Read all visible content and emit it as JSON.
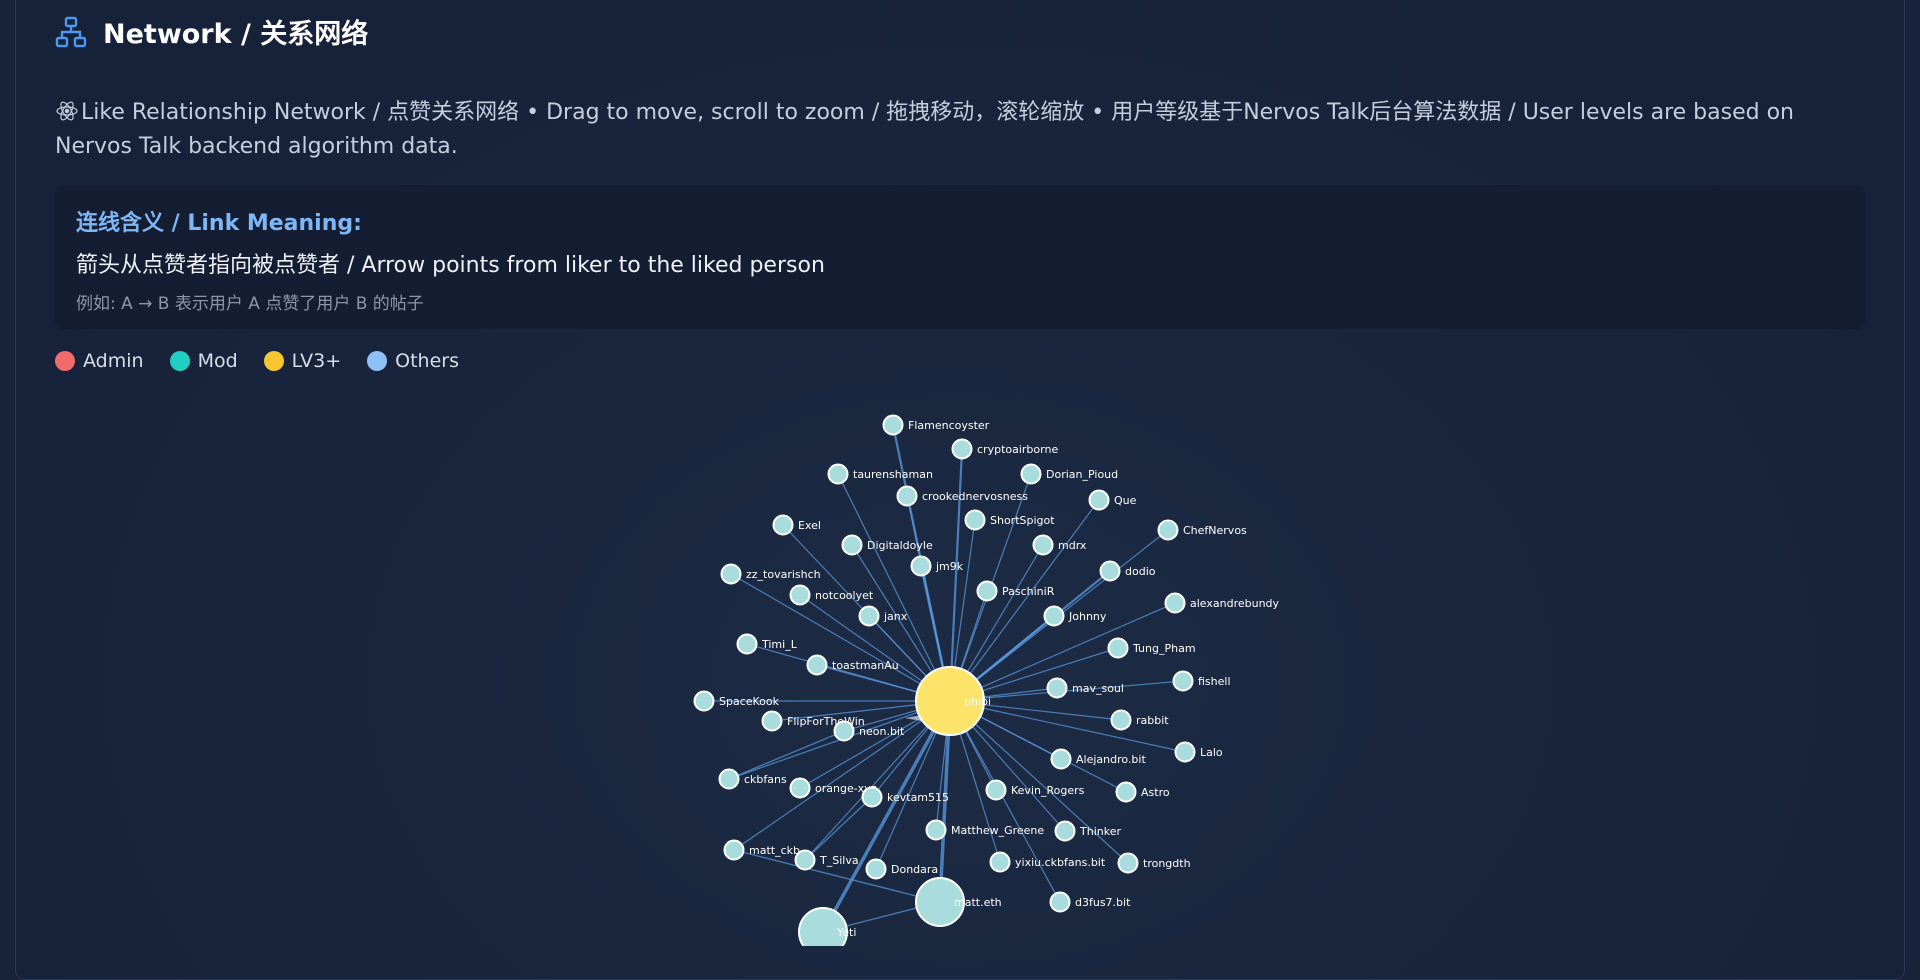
{
  "header": {
    "title": "Network / 关系网络",
    "icon": "network-icon"
  },
  "description": "Like Relationship Network / 点赞关系网络 • Drag to move, scroll to zoom / 拖拽移动，滚轮缩放 • 用户等级基于Nervos Talk后台算法数据 / User levels are based on Nervos Talk backend algorithm data.",
  "link_info": {
    "heading": "连线含义 / Link Meaning:",
    "meaning": "箭头从点赞者指向被点赞者 / Arrow points from liker to the liked person",
    "example": "例如: A → B 表示用户 A 点赞了用户 B 的帖子"
  },
  "legend": [
    {
      "label": "Admin",
      "color": "#f26b6b"
    },
    {
      "label": "Mod",
      "color": "#1fcfc1"
    },
    {
      "label": "LV3+",
      "color": "#f8c630"
    },
    {
      "label": "Others",
      "color": "#8fc1f7"
    }
  ],
  "colors": {
    "node_default": "#a9dcdc",
    "node_center": "#fce36a",
    "link": "#5b9be0",
    "panel_bg": "#18233a"
  },
  "network": {
    "nodes": [
      {
        "id": "Flamencoyster",
        "label": "Flamencoyster"
      },
      {
        "id": "cryptoairborne",
        "label": "cryptoairborne"
      },
      {
        "id": "taurenshaman",
        "label": "taurenshaman"
      },
      {
        "id": "Dorian_Pioud",
        "label": "Dorian_Pioud"
      },
      {
        "id": "crookednervosness",
        "label": "crookednervosness"
      },
      {
        "id": "Que",
        "label": "Que"
      },
      {
        "id": "ShortSpigot",
        "label": "ShortSpigot"
      },
      {
        "id": "Exel",
        "label": "Exel"
      },
      {
        "id": "ChefNervos",
        "label": "ChefNervos"
      },
      {
        "id": "Digitaldoyle",
        "label": "Digitaldoyle"
      },
      {
        "id": "mdrx",
        "label": "mdrx"
      },
      {
        "id": "jm9k",
        "label": "jm9k"
      },
      {
        "id": "dodio",
        "label": "dodio"
      },
      {
        "id": "zz_tovarishch",
        "label": "zz_tovarishch"
      },
      {
        "id": "PaschiniR",
        "label": "PaschiniR"
      },
      {
        "id": "notcoolyet",
        "label": "notcoolyet"
      },
      {
        "id": "alexandrebundy",
        "label": "alexandrebundy"
      },
      {
        "id": "janx",
        "label": "janx"
      },
      {
        "id": "Johnny",
        "label": "Johnny"
      },
      {
        "id": "Timi_L",
        "label": "Timi_L"
      },
      {
        "id": "Tung_Pham",
        "label": "Tung_Pham"
      },
      {
        "id": "toastmanAu",
        "label": "toastmanAu"
      },
      {
        "id": "fishell",
        "label": "fishell"
      },
      {
        "id": "mav_soul",
        "label": "mav_soul"
      },
      {
        "id": "phibi",
        "label": "phibi",
        "center": true
      },
      {
        "id": "SpaceKook",
        "label": "SpaceKook"
      },
      {
        "id": "rabbit",
        "label": "rabbit"
      },
      {
        "id": "FlipForTheWin",
        "label": "FlipForTheWin"
      },
      {
        "id": "neon.bit",
        "label": "neon.bit"
      },
      {
        "id": "Lalo",
        "label": "Lalo"
      },
      {
        "id": "Alejandro.bit",
        "label": "Alejandro.bit"
      },
      {
        "id": "ckbfans",
        "label": "ckbfans"
      },
      {
        "id": "orange-xyz",
        "label": "orange-xyz"
      },
      {
        "id": "Astro",
        "label": "Astro"
      },
      {
        "id": "Kevin_Rogers",
        "label": "Kevin_Rogers"
      },
      {
        "id": "kevtam515",
        "label": "kevtam515"
      },
      {
        "id": "Matthew_Greene",
        "label": "Matthew_Greene"
      },
      {
        "id": "Thinker",
        "label": "Thinker"
      },
      {
        "id": "matt_ckb",
        "label": "matt_ckb"
      },
      {
        "id": "T_Silva",
        "label": "T_Silva"
      },
      {
        "id": "yixiu.ckbfans.bit",
        "label": "yixiu.ckbfans.bit"
      },
      {
        "id": "trongdth",
        "label": "trongdth"
      },
      {
        "id": "Dondara",
        "label": "Dondara"
      },
      {
        "id": "matt.eth",
        "label": "matt.eth",
        "big": true
      },
      {
        "id": "d3fus7.bit",
        "label": "d3fus7.bit"
      },
      {
        "id": "Yeti",
        "label": "Yeti",
        "big": true
      }
    ],
    "extra_links": [
      [
        "matt_ckb",
        "matt.eth"
      ],
      [
        "ckbfans",
        "neon.bit"
      ],
      [
        "T_Silva",
        "kevtam515"
      ],
      [
        "Yeti",
        "matt.eth"
      ]
    ]
  }
}
